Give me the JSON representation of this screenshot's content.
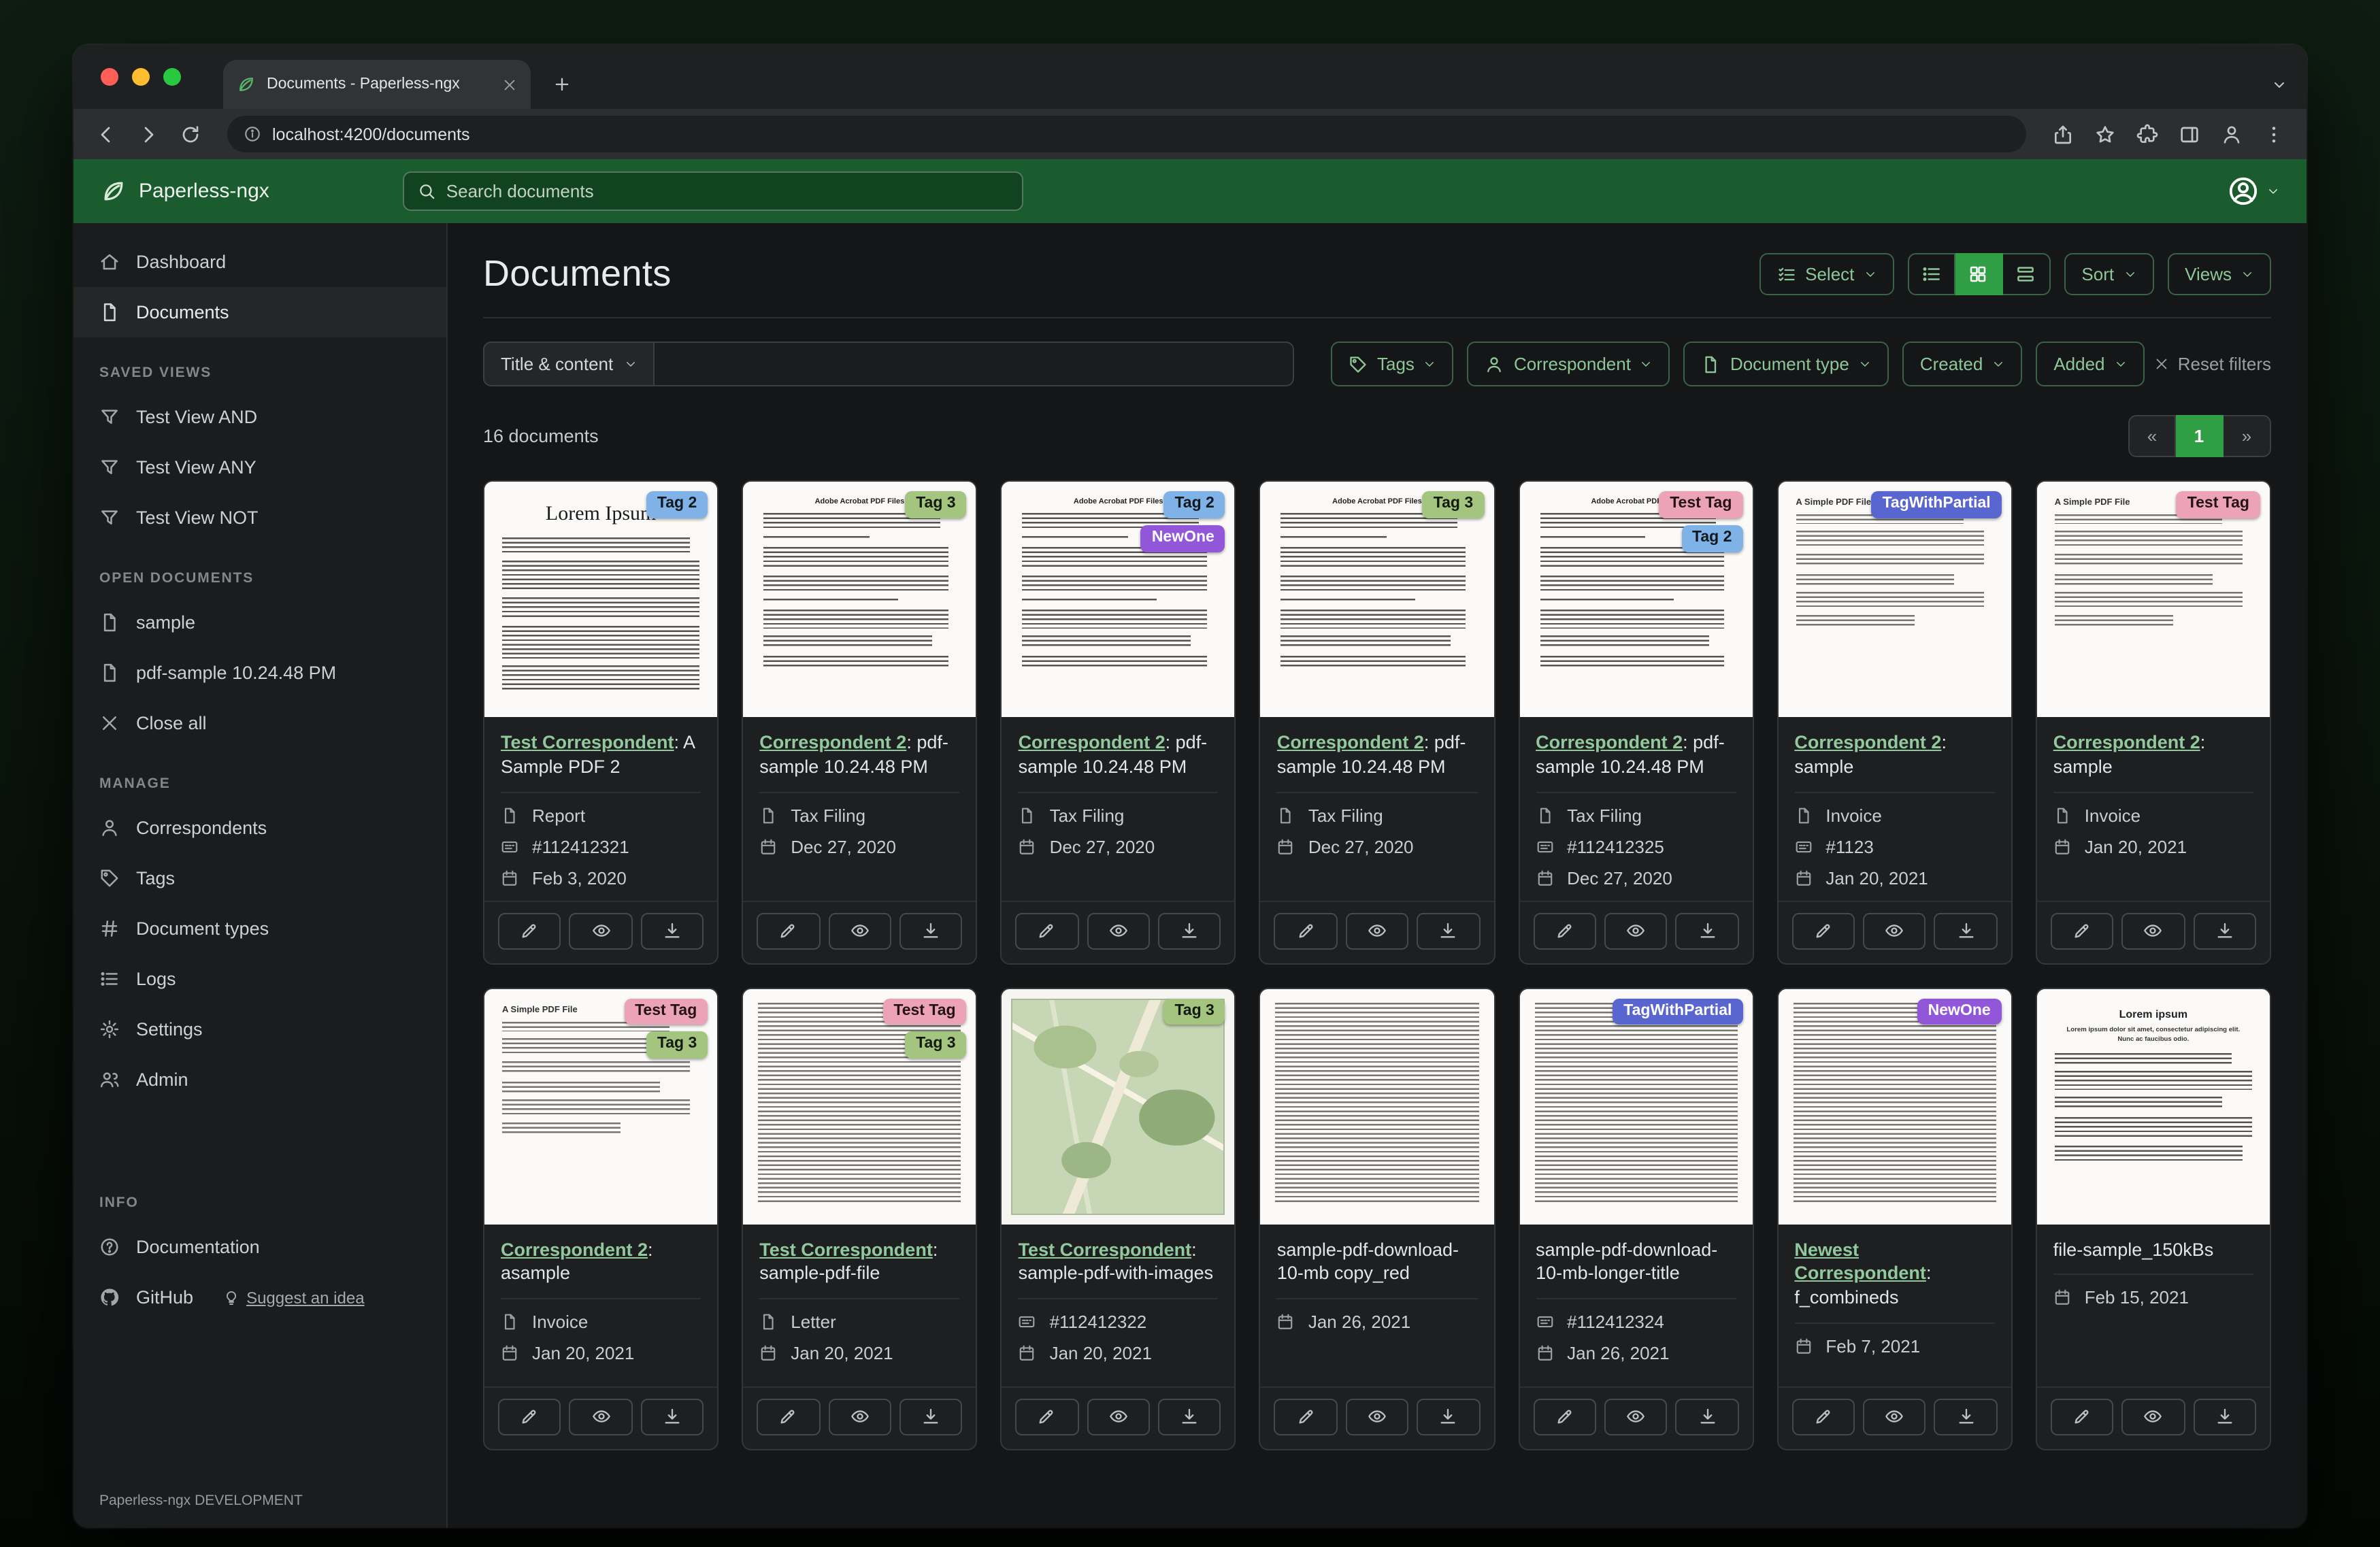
{
  "window": {
    "tab_title": "Documents - Paperless-ngx",
    "url": "localhost:4200/documents"
  },
  "header": {
    "brand": "Paperless-ngx",
    "search_placeholder": "Search documents"
  },
  "sidebar": {
    "primary": [
      {
        "icon": "home",
        "label": "Dashboard"
      },
      {
        "icon": "file",
        "label": "Documents",
        "active": true
      }
    ],
    "sections": [
      {
        "title": "SAVED VIEWS",
        "items": [
          {
            "icon": "funnel",
            "label": "Test View AND"
          },
          {
            "icon": "funnel",
            "label": "Test View ANY"
          },
          {
            "icon": "funnel",
            "label": "Test View NOT"
          }
        ]
      },
      {
        "title": "OPEN DOCUMENTS",
        "items": [
          {
            "icon": "file",
            "label": "sample"
          },
          {
            "icon": "file",
            "label": "pdf-sample 10.24.48 PM"
          },
          {
            "icon": "close",
            "label": "Close all"
          }
        ]
      },
      {
        "title": "MANAGE",
        "items": [
          {
            "icon": "person",
            "label": "Correspondents"
          },
          {
            "icon": "tag",
            "label": "Tags"
          },
          {
            "icon": "hash",
            "label": "Document types"
          },
          {
            "icon": "list",
            "label": "Logs"
          },
          {
            "icon": "gear",
            "label": "Settings"
          },
          {
            "icon": "people",
            "label": "Admin"
          }
        ]
      },
      {
        "title": "INFO",
        "items": [
          {
            "icon": "question",
            "label": "Documentation"
          },
          {
            "icon": "github",
            "label": "GitHub",
            "extra": {
              "icon": "bulb",
              "label": "Suggest an idea"
            }
          }
        ]
      }
    ],
    "footer": "Paperless-ngx DEVELOPMENT"
  },
  "page": {
    "title": "Documents",
    "select_label": "Select",
    "sort_label": "Sort",
    "views_label": "Views"
  },
  "filters": {
    "title_content_label": "Title & content",
    "tags_label": "Tags",
    "correspondent_label": "Correspondent",
    "document_type_label": "Document type",
    "created_label": "Created",
    "added_label": "Added",
    "reset_label": "Reset filters"
  },
  "results": {
    "count_text": "16 documents",
    "prev": "«",
    "page": "1",
    "next": "»"
  },
  "colors": {
    "header_green": "#1a5c2e",
    "accent_green": "#2f9e44",
    "link_green": "#92c99c"
  },
  "tag_colors": {
    "Tag 2": {
      "bg": "#7fb2e6",
      "fg": "#101820"
    },
    "Tag 3": {
      "bg": "#a4c57f",
      "fg": "#141a0d"
    },
    "NewOne": {
      "bg": "#9257d8",
      "fg": "#ffffff"
    },
    "Test Tag": {
      "bg": "#eca2b7",
      "fg": "#241218"
    },
    "TagWithPartial": {
      "bg": "#5a66cf",
      "fg": "#ffffff"
    }
  },
  "documents": [
    {
      "tags": [
        "Tag 2"
      ],
      "correspondent": "Test Correspondent",
      "title_rest": ": A Sample PDF 2",
      "type": "Report",
      "asn": "#112412321",
      "date": "Feb 3, 2020",
      "thumb": "lorem",
      "thumb_title": "Lorem Ipsum"
    },
    {
      "tags": [
        "Tag 3"
      ],
      "correspondent": "Correspondent 2",
      "title_rest": ": pdf-sample 10.24.48 PM",
      "type": "Tax Filing",
      "date": "Dec 27, 2020",
      "thumb": "acrobat",
      "thumb_title": "Adobe Acrobat PDF Files"
    },
    {
      "tags": [
        "Tag 2",
        "NewOne"
      ],
      "correspondent": "Correspondent 2",
      "title_rest": ": pdf-sample 10.24.48 PM",
      "type": "Tax Filing",
      "date": "Dec 27, 2020",
      "thumb": "acrobat",
      "thumb_title": "Adobe Acrobat PDF Files"
    },
    {
      "tags": [
        "Tag 3"
      ],
      "correspondent": "Correspondent 2",
      "title_rest": ": pdf-sample 10.24.48 PM",
      "type": "Tax Filing",
      "date": "Dec 27, 2020",
      "thumb": "acrobat",
      "thumb_title": "Adobe Acrobat PDF Files"
    },
    {
      "tags": [
        "Test Tag",
        "Tag 2"
      ],
      "correspondent": "Correspondent 2",
      "title_rest": ": pdf-sample 10.24.48 PM",
      "type": "Tax Filing",
      "asn": "#112412325",
      "date": "Dec 27, 2020",
      "thumb": "acrobat",
      "thumb_title": "Adobe Acrobat PDF Files"
    },
    {
      "tags": [
        "TagWithPartial"
      ],
      "correspondent": "Correspondent 2",
      "title_rest": ": sample",
      "type": "Invoice",
      "asn": "#1123",
      "date": "Jan 20, 2021",
      "thumb": "simple",
      "thumb_title": "A Simple PDF File"
    },
    {
      "tags": [
        "Test Tag"
      ],
      "correspondent": "Correspondent 2",
      "title_rest": ": sample",
      "type": "Invoice",
      "date": "Jan 20, 2021",
      "thumb": "simple",
      "thumb_title": "A Simple PDF File"
    },
    {
      "tags": [
        "Test Tag",
        "Tag 3"
      ],
      "correspondent": "Correspondent 2",
      "title_rest": ": asample",
      "type": "Invoice",
      "date": "Jan 20, 2021",
      "thumb": "simple",
      "thumb_title": "A Simple PDF File"
    },
    {
      "tags": [
        "Test Tag",
        "Tag 3"
      ],
      "correspondent": "Test Correspondent",
      "title_rest": ": sample-pdf-file",
      "type": "Letter",
      "date": "Jan 20, 2021",
      "thumb": "dense"
    },
    {
      "tags": [
        "Tag 3"
      ],
      "correspondent": "Test Correspondent",
      "title_rest": ": sample-pdf-with-images",
      "asn": "#112412322",
      "date": "Jan 20, 2021",
      "thumb": "map"
    },
    {
      "tags": [],
      "title_rest": "sample-pdf-download-10-mb copy_red",
      "date": "Jan 26, 2021",
      "thumb": "dense"
    },
    {
      "tags": [
        "TagWithPartial"
      ],
      "title_rest": "sample-pdf-download-10-mb-longer-title",
      "asn": "#112412324",
      "date": "Jan 26, 2021",
      "thumb": "dense"
    },
    {
      "tags": [
        "NewOne"
      ],
      "correspondent": "Newest Correspondent",
      "title_rest": ": f_combineds",
      "date": "Feb 7, 2021",
      "thumb": "dense"
    },
    {
      "tags": [],
      "title_rest": "file-sample_150kBs",
      "date": "Feb 15, 2021",
      "thumb": "lorem2",
      "thumb_title": "Lorem ipsum",
      "thumb_sub": "Lorem ipsum dolor sit amet, consectetur adipiscing elit. Nunc ac faucibus odio."
    }
  ]
}
